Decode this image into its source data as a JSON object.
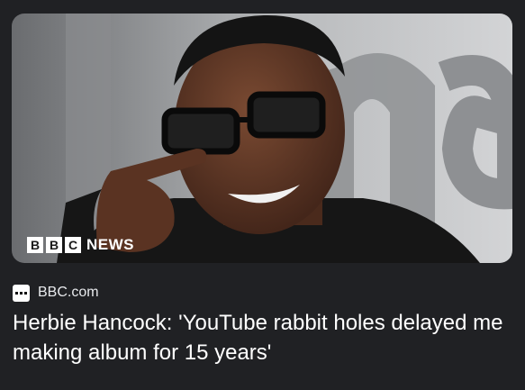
{
  "card": {
    "image": {
      "brand_boxes": [
        "B",
        "B",
        "C"
      ],
      "brand_word": "NEWS"
    },
    "source": {
      "favicon": "bbc-favicon-icon",
      "name": "BBC.com"
    },
    "headline": "Herbie Hancock: 'YouTube rabbit holes delayed me making album for 15 years'"
  },
  "colors": {
    "background": "#202124",
    "headline_text": "#ffffff",
    "source_text": "#e8eaed"
  }
}
